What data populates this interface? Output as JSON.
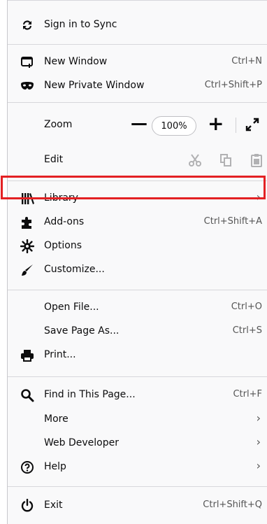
{
  "menu": {
    "sync": {
      "label": "Sign in to Sync"
    },
    "new_window": {
      "label": "New Window",
      "shortcut": "Ctrl+N"
    },
    "new_private": {
      "label": "New Private Window",
      "shortcut": "Ctrl+Shift+P"
    },
    "zoom": {
      "label": "Zoom",
      "minus": "—",
      "level": "100%",
      "plus": "+"
    },
    "edit": {
      "label": "Edit"
    },
    "library": {
      "label": "Library",
      "arrow": "›"
    },
    "addons": {
      "label": "Add-ons",
      "shortcut": "Ctrl+Shift+A"
    },
    "options": {
      "label": "Options"
    },
    "customize": {
      "label": "Customize..."
    },
    "open_file": {
      "label": "Open File...",
      "shortcut": "Ctrl+O"
    },
    "save_page": {
      "label": "Save Page As...",
      "shortcut": "Ctrl+S"
    },
    "print": {
      "label": "Print..."
    },
    "find": {
      "label": "Find in This Page...",
      "shortcut": "Ctrl+F"
    },
    "more": {
      "label": "More",
      "arrow": "›"
    },
    "web_dev": {
      "label": "Web Developer",
      "arrow": "›"
    },
    "help": {
      "label": "Help",
      "arrow": "›"
    },
    "exit": {
      "label": "Exit",
      "shortcut": "Ctrl+Shift+Q"
    }
  },
  "icons": {
    "sync": "sync-icon",
    "new_window": "new-window-icon",
    "private": "mask-icon",
    "cut": "cut-icon",
    "copy": "copy-icon",
    "paste": "paste-icon",
    "library": "library-icon",
    "addons": "puzzle-icon",
    "options": "gear-icon",
    "customize": "brush-icon",
    "print": "printer-icon",
    "find": "search-icon",
    "help": "help-icon",
    "exit": "power-icon",
    "fullscreen": "fullscreen-icon"
  },
  "colors": {
    "highlight": "#e32023",
    "menu_bg": "#f9f9fa",
    "text": "#0c0c0d"
  }
}
